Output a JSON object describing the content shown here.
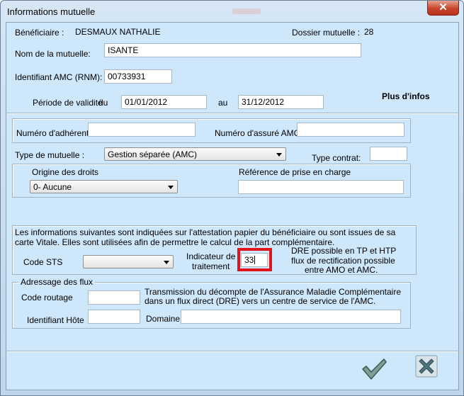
{
  "window": {
    "title": "Informations mutuelle",
    "close_label": "✕"
  },
  "header": {
    "beneficiaire_label": "Bénéficiaire :",
    "beneficiaire_value": "DESMAUX NATHALIE",
    "dossier_label": "Dossier mutuelle :",
    "dossier_value": "28"
  },
  "mutuelle": {
    "nom_label": "Nom de la mutuelle:",
    "nom_value": "ISANTE",
    "identifiant_label": "Identifiant AMC (RNM):",
    "identifiant_value": "00733931",
    "periode_label": "Période de validité",
    "du_label": "du",
    "du_value": "01/01/2012",
    "au_label": "au",
    "au_value": "31/12/2012",
    "plus_infos": "Plus d'infos"
  },
  "adherent": {
    "numero_adherent_label": "Numéro d'adhérent :",
    "numero_adherent_value": "",
    "numero_assure_label": "Numéro d'assuré AMC :",
    "numero_assure_value": ""
  },
  "type": {
    "type_mutuelle_label": "Type de mutuelle :",
    "type_mutuelle_value": "Gestion séparée (AMC)",
    "type_contrat_label": "Type contrat:",
    "type_contrat_value": ""
  },
  "droits": {
    "origine_label": "Origine des droits",
    "origine_value": "0- Aucune",
    "reference_label": "Référence de prise en charge",
    "reference_value": ""
  },
  "attestation": {
    "info_text": "Les informations suivantes sont indiquées sur l'attestation papier du bénéficiaire ou sont issues de sa carte Vitale. Elles sont utilisées afin de permettre le calcul de la part complémentaire.",
    "code_sts_label": "Code STS",
    "code_sts_value": "",
    "indicateur_label_1": "Indicateur de",
    "indicateur_label_2": "traitement",
    "indicateur_value": "33",
    "dre_line_1": "DRE possible en TP et HTP",
    "dre_line_2": "flux de rectification possible",
    "dre_line_3": "entre AMO et AMC."
  },
  "flux": {
    "legend": "Adressage des flux",
    "code_routage_label": "Code routage",
    "code_routage_value": "",
    "transmission_text": "Transmission du décompte de l'Assurance Maladie Complémentaire dans un flux direct (DRE) vers un centre de service de l'AMC.",
    "identifiant_hote_label": "Identifiant Hôte",
    "identifiant_hote_value": "",
    "domaine_label": "Domaine",
    "domaine_value": ""
  },
  "footer": {
    "validate_icon": "checkmark-icon",
    "cancel_icon": "cross-icon"
  },
  "colors": {
    "background": "#cfe7fb",
    "highlight": "#e0141a",
    "check": "#6f8f8a",
    "cross": "#4a6f76"
  }
}
